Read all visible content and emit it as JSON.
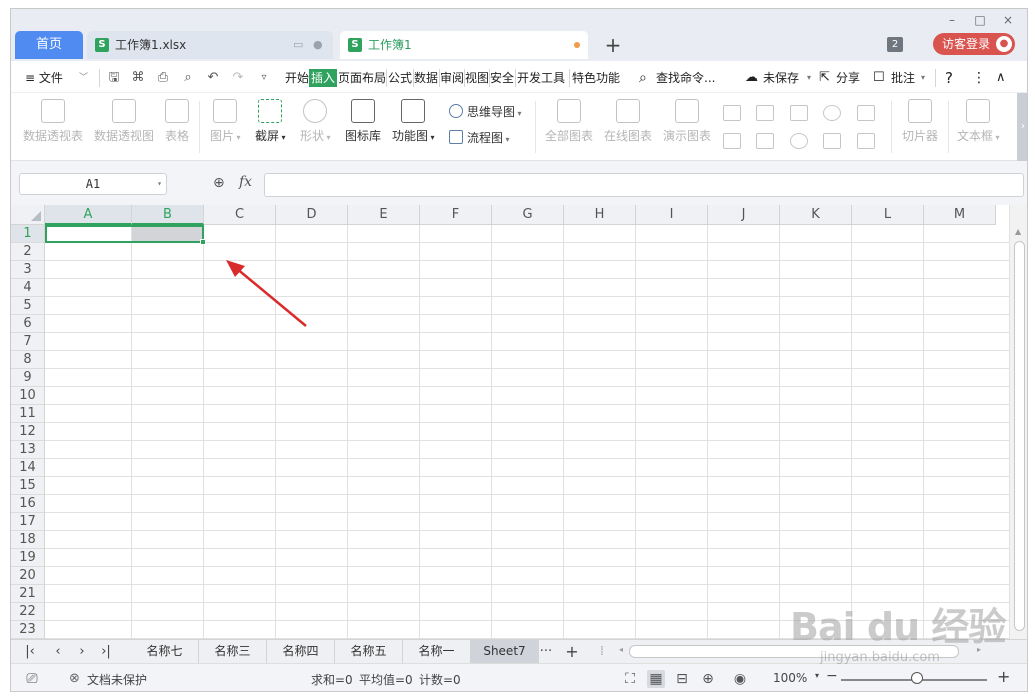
{
  "window": {
    "minimize": "–",
    "maximize": "□",
    "close": "×"
  },
  "tabs": {
    "home": "首页",
    "file_tab": {
      "icon": "S",
      "label": "工作簿1.xlsx"
    },
    "active_tab": {
      "icon": "S",
      "label": "工作簿1"
    },
    "new_tab": "+",
    "window_count": "2",
    "login": "访客登录"
  },
  "menu": {
    "file": "≡ 文件",
    "items": [
      "开始",
      "插入",
      "页面布局",
      "公式",
      "数据",
      "审阅",
      "视图",
      "安全",
      "开发工具",
      "特色功能"
    ],
    "active_index": 1,
    "search": "查找命令...",
    "unsaved": "未保存",
    "share": "分享",
    "comment": "批注",
    "help": "?"
  },
  "ribbon": {
    "pivot_table": "数据透视表",
    "pivot_chart": "数据透视图",
    "table": "表格",
    "picture": "图片",
    "screenshot": "截屏",
    "shapes": "形状",
    "icon_lib": "图标库",
    "func_chart": "功能图",
    "mindmap": "思维导图",
    "flowchart": "流程图",
    "all_charts": "全部图表",
    "online_charts": "在线图表",
    "demo_charts": "演示图表",
    "slicer": "切片器",
    "textbox": "文本框"
  },
  "formula_bar": {
    "cell_ref": "A1",
    "fx": "fx",
    "value": ""
  },
  "grid": {
    "columns": [
      "A",
      "B",
      "C",
      "D",
      "E",
      "F",
      "G",
      "H",
      "I",
      "J",
      "K",
      "L",
      "M"
    ],
    "rows": [
      "1",
      "2",
      "3",
      "4",
      "5",
      "6",
      "7",
      "8",
      "9",
      "10",
      "11",
      "12",
      "13",
      "14",
      "15",
      "16",
      "17",
      "18",
      "19",
      "20",
      "21",
      "22",
      "23"
    ],
    "selection": "A1:B1"
  },
  "sheets": {
    "tabs": [
      "名称七",
      "名称三",
      "名称四",
      "名称五",
      "名称一",
      "Sheet7"
    ],
    "active": "Sheet7",
    "more": "···",
    "add": "+"
  },
  "status": {
    "protect": "文档未保护",
    "sum": "求和=0",
    "avg": "平均值=0",
    "count": "计数=0",
    "zoom": "100%"
  },
  "watermark": {
    "brand": "Bai du 经验",
    "url": "jingyan.baidu.com"
  },
  "colors": {
    "accent": "#2fa35d",
    "home_tab": "#4f8bf0",
    "login": "#d9534f",
    "arrow": "#d92b2b"
  }
}
